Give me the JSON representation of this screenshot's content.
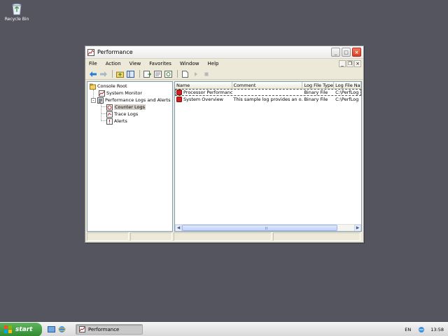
{
  "desktop": {
    "recycle_bin_label": "Recycle Bin"
  },
  "window": {
    "title": "Performance",
    "controls": {
      "minimize": "_",
      "maximize": "□",
      "close": "×"
    },
    "child_controls": {
      "minimize": "_",
      "restore": "❐",
      "close": "×"
    },
    "menu": [
      "File",
      "Action",
      "View",
      "Favorites",
      "Window",
      "Help"
    ],
    "toolbar_icons": [
      "back-icon",
      "forward-icon",
      "up-folder-icon",
      "show-hide-tree-icon",
      "export-list-icon",
      "properties-icon",
      "refresh-icon",
      "new-log-icon",
      "start-log-icon",
      "stop-log-icon"
    ]
  },
  "tree": {
    "root": "Console Root",
    "items": [
      {
        "label": "System Monitor"
      },
      {
        "label": "Performance Logs and Alerts"
      },
      {
        "label": "Counter Logs"
      },
      {
        "label": "Trace Logs"
      },
      {
        "label": "Alerts"
      }
    ],
    "expander": "-",
    "selected": "Counter Logs"
  },
  "list": {
    "columns": [
      "Name",
      "Comment",
      "Log File Type",
      "Log File Na"
    ],
    "rows": [
      {
        "name": "Processor Performance",
        "comment": "",
        "type": "Binary File",
        "file": "C:\\PerfLog"
      },
      {
        "name": "System Overview",
        "comment": "This sample log provides an o...",
        "type": "Binary File",
        "file": "C:\\PerfLog"
      }
    ]
  },
  "taskbar": {
    "start_label": "start",
    "task_label": "Performance",
    "language": "EN",
    "clock": "13:58"
  },
  "colors": {
    "desktop": "#555560",
    "start_green": "#3a9a3a",
    "log_icon_red": "#d02020"
  }
}
